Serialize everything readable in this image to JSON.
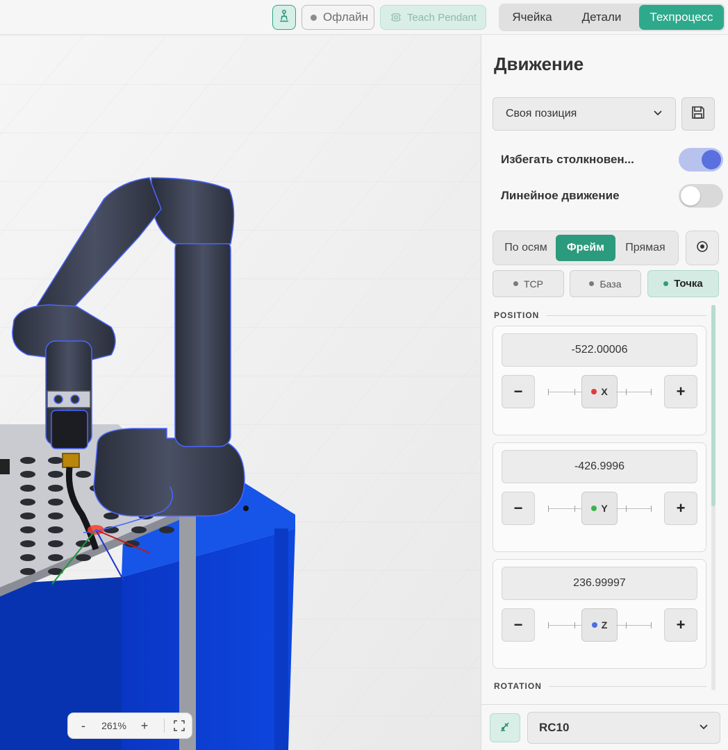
{
  "topbar": {
    "status": "Офлайн",
    "teach_pendant": "Teach Pendant",
    "tabs": [
      {
        "label": "Ячейка",
        "active": false
      },
      {
        "label": "Детали",
        "active": false
      },
      {
        "label": "Техпроцесс",
        "active": true
      }
    ]
  },
  "viewport": {
    "zoom": {
      "minus": "-",
      "value": "261%",
      "plus": "+"
    }
  },
  "panel": {
    "title": "Движение",
    "position_select": "Своя позиция",
    "toggles": [
      {
        "label": "Избегать столкновен...",
        "on": true
      },
      {
        "label": "Линейное движение",
        "on": false
      }
    ],
    "modes": [
      {
        "label": "По осям",
        "active": false
      },
      {
        "label": "Фрейм",
        "active": true
      },
      {
        "label": "Прямая",
        "active": false
      }
    ],
    "frames": [
      {
        "label": "TCP",
        "active": false
      },
      {
        "label": "База",
        "active": false
      },
      {
        "label": "Точка",
        "active": true
      }
    ],
    "position_header": "POSITION",
    "rotation_header": "ROTATION",
    "axes": [
      {
        "value": "-522.00006",
        "label": "X",
        "color": "#e03b3b"
      },
      {
        "value": "-426.9996",
        "label": "Y",
        "color": "#3bb34a"
      },
      {
        "value": "236.99997",
        "label": "Z",
        "color": "#4a6fe0"
      }
    ],
    "minus": "−",
    "plus": "+",
    "robot": "RC10"
  },
  "colors": {
    "accent": "#2fa98c",
    "toggle_on": "#5a70de"
  }
}
